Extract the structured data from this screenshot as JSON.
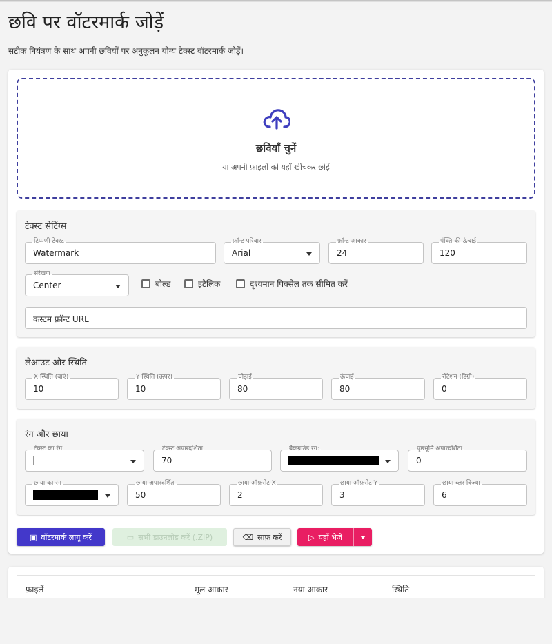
{
  "page": {
    "title": "छवि पर वॉटरमार्क जोड़ें",
    "subtitle": "सटीक नियंत्रण के साथ अपनी छवियों पर अनुकूलन योग्य टेक्स्ट वॉटरमार्क जोड़ें।"
  },
  "dropzone": {
    "icon": "cloud-upload-icon",
    "title": "छवियाँ चुनें",
    "hint": "या अपनी फ़ाइलों को यहाँ खींचकर छोड़ें"
  },
  "text_settings": {
    "title": "टेक्स्ट सेटिंग्स",
    "comment_text": {
      "label": "टिप्पणी टेक्स्ट",
      "value": "Watermark"
    },
    "font_family": {
      "label": "फ़ॉन्ट परिवार",
      "value": "Arial"
    },
    "font_size": {
      "label": "फ़ॉन्ट आकार",
      "value": "24"
    },
    "line_height": {
      "label": "पंक्ति की ऊंचाई",
      "value": "120"
    },
    "alignment": {
      "label": "संरेखण",
      "value": "Center"
    },
    "bold_label": "बोल्ड",
    "italic_label": "इटैलिक",
    "clip_label": "दृश्यमान पिक्सेल तक सीमित करें",
    "custom_font_url": {
      "placeholder": "कस्टम फ़ॉन्ट URL"
    }
  },
  "layout": {
    "title": "लेआउट और स्थिति",
    "x_pos": {
      "label": "X स्थिति (बाएं)",
      "value": "10"
    },
    "y_pos": {
      "label": "Y स्थिति (ऊपर)",
      "value": "10"
    },
    "width": {
      "label": "चौड़ाई",
      "value": "80"
    },
    "height": {
      "label": "ऊंचाई",
      "value": "80"
    },
    "rotation": {
      "label": "रोटेशन (डिग्री)",
      "value": "0"
    }
  },
  "colors": {
    "title": "रंग और छाया",
    "text_color": {
      "label": "टेक्स्ट का रंग",
      "value": "#ffffff"
    },
    "text_opacity": {
      "label": "टेक्स्ट अपारदर्शिता",
      "value": "70"
    },
    "bg_color": {
      "label": "बैकग्राउंड रंग:",
      "value": "#000000"
    },
    "bg_opacity": {
      "label": "पृष्ठभूमि अपारदर्शिता",
      "value": "0"
    },
    "shadow_color": {
      "label": "छाया का रंग",
      "value": "#000000"
    },
    "shadow_opacity": {
      "label": "छाया अपारदर्शिता",
      "value": "50"
    },
    "shadow_offset_x": {
      "label": "छाया ऑफ़सेट X",
      "value": "2"
    },
    "shadow_offset_y": {
      "label": "छाया ऑफ़सेट Y",
      "value": "3"
    },
    "shadow_blur": {
      "label": "छाया ब्लर त्रिज्या",
      "value": "6"
    }
  },
  "actions": {
    "apply": "वॉटरमार्क लागू करें",
    "download_all": "सभी डाउनलोड करें (.ZIP)",
    "clear": "साफ़ करें",
    "send_here": "यहाँ भेजें"
  },
  "table": {
    "columns": [
      "फ़ाइलें",
      "मूल आकार",
      "नया आकार",
      "स्थिति"
    ]
  },
  "colors_theme": {
    "primary": "#4338ca",
    "accent": "#e91e63",
    "disabled_bg": "#dff0df"
  }
}
